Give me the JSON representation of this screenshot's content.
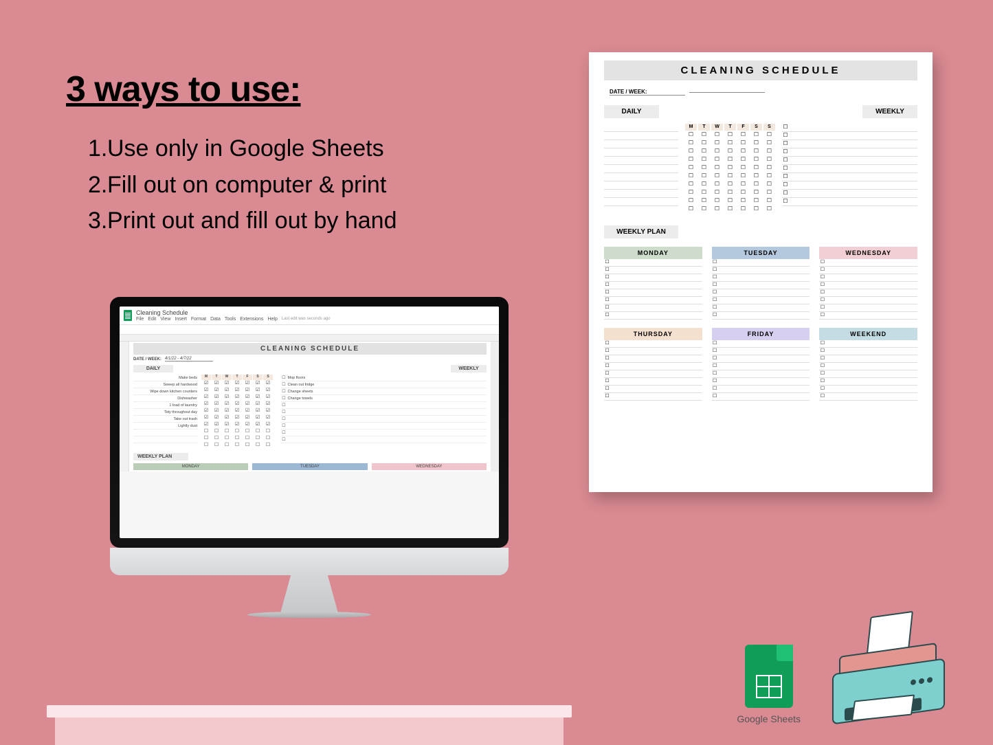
{
  "heading": "3 ways to use:",
  "list": {
    "one": "Use only in Google Sheets",
    "two": "Fill out on computer & print",
    "three": "Print out and fill out by hand"
  },
  "gsheets_badge_label": "Google Sheets",
  "gs_app": {
    "doc_name": "Cleaning Schedule",
    "menus": [
      "File",
      "Edit",
      "View",
      "Insert",
      "Format",
      "Data",
      "Tools",
      "Extensions",
      "Help"
    ],
    "last_edit": "Last edit was seconds ago"
  },
  "sheet": {
    "title": "CLEANING SCHEDULE",
    "date_label": "DATE / WEEK:",
    "date_value": "4/1/22 - 4/7/22",
    "daily_label": "DAILY",
    "weekly_label": "WEEKLY",
    "weekly_plan_label": "WEEKLY PLAN",
    "day_heads": [
      "M",
      "T",
      "W",
      "T",
      "F",
      "S",
      "S"
    ],
    "daily_tasks": [
      "Make beds",
      "Sweep all hardwood",
      "Wipe down kitchen counters",
      "Dishwasher",
      "1 load of laundry",
      "Tidy throughout day",
      "Take out trash",
      "Lightly dust"
    ],
    "daily_checks": [
      [
        1,
        1,
        1,
        1,
        1,
        1,
        1
      ],
      [
        1,
        1,
        1,
        1,
        1,
        1,
        1
      ],
      [
        1,
        1,
        1,
        1,
        1,
        1,
        1
      ],
      [
        1,
        1,
        1,
        1,
        1,
        1,
        1
      ],
      [
        1,
        1,
        1,
        1,
        1,
        1,
        1
      ],
      [
        1,
        1,
        1,
        1,
        1,
        1,
        1
      ],
      [
        1,
        1,
        1,
        1,
        1,
        1,
        1
      ],
      [
        0,
        0,
        0,
        0,
        0,
        0,
        0
      ]
    ],
    "weekly_tasks": [
      "Mop floors",
      "Clean out fridge",
      "Change sheets",
      "Change towels"
    ],
    "plan_days_row1": [
      "MONDAY",
      "TUESDAY",
      "WEDNESDAY"
    ]
  },
  "paper": {
    "title": "CLEANING SCHEDULE",
    "date_label": "DATE / WEEK:",
    "daily_label": "DAILY",
    "weekly_label": "WEEKLY",
    "weekly_plan_label": "WEEKLY PLAN",
    "day_heads": [
      "M",
      "T",
      "W",
      "T",
      "F",
      "S",
      "S"
    ],
    "plan_row1": [
      "MONDAY",
      "TUESDAY",
      "WEDNESDAY"
    ],
    "plan_row2": [
      "THURSDAY",
      "FRIDAY",
      "WEEKEND"
    ]
  }
}
